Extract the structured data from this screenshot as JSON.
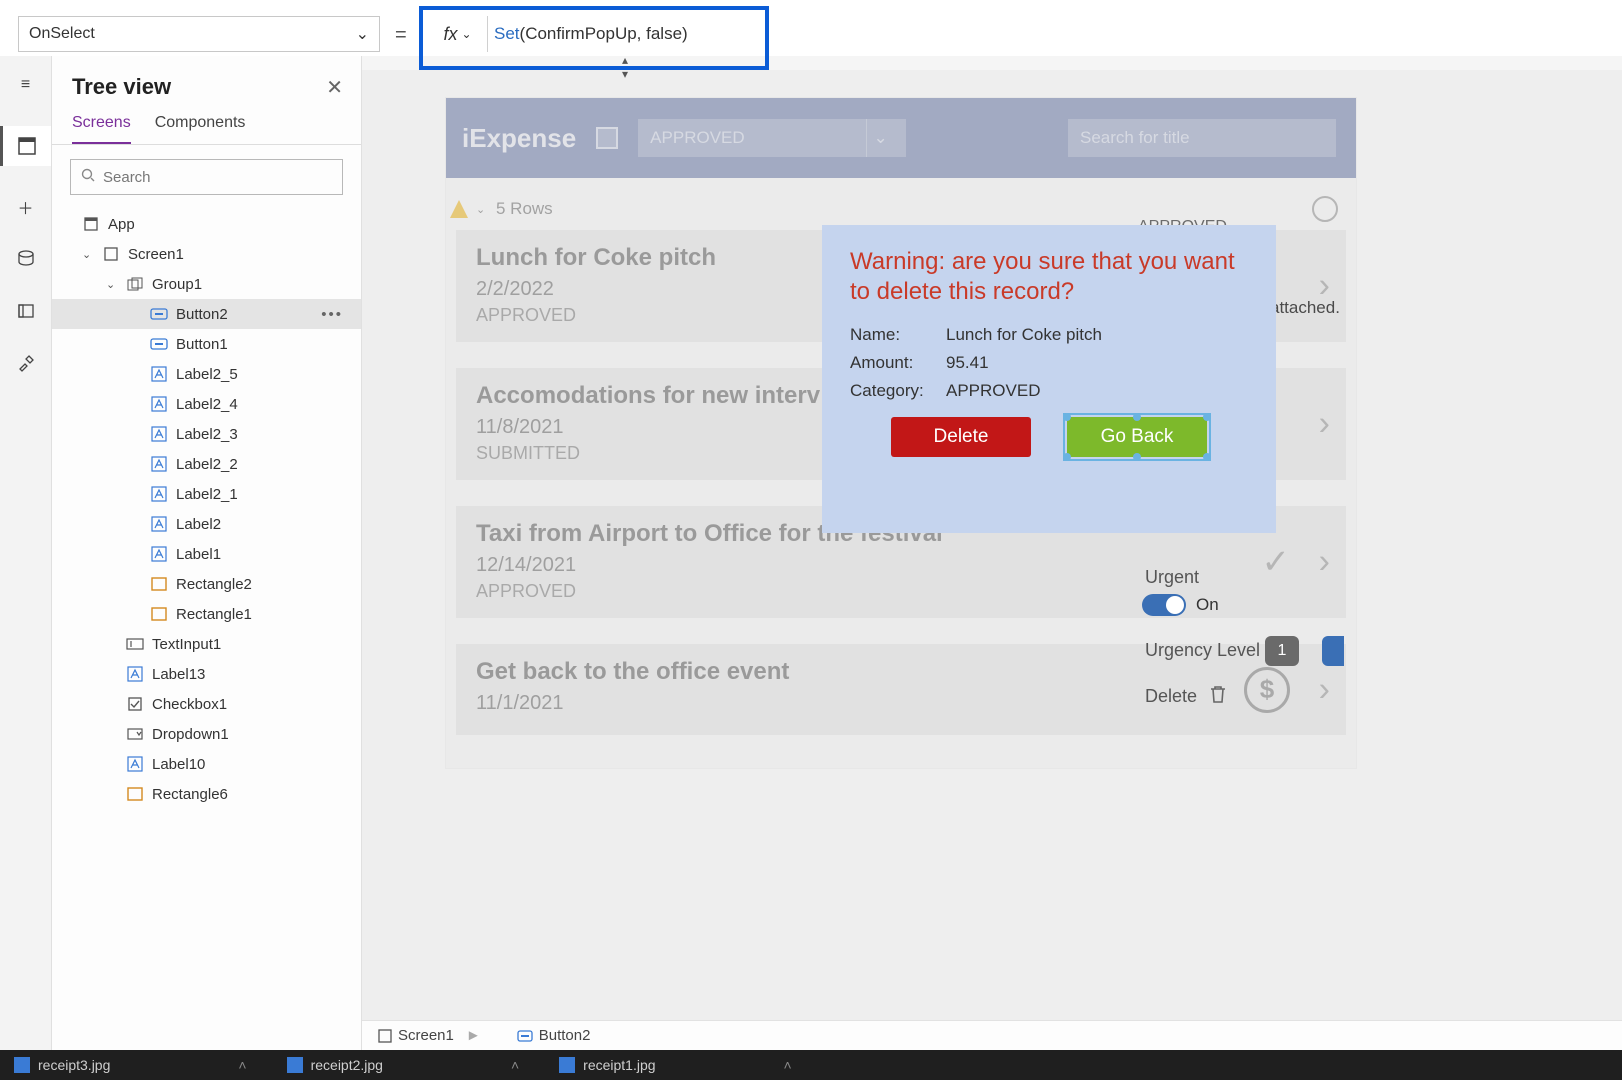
{
  "formula_bar": {
    "property": "OnSelect",
    "fx_label": "fx",
    "formula_fn": "Set",
    "formula_rest": "(ConfirmPopUp, false)"
  },
  "tree": {
    "title": "Tree view",
    "tabs": {
      "screens": "Screens",
      "components": "Components"
    },
    "search_placeholder": "Search",
    "items": [
      {
        "label": "App",
        "indent": 0,
        "icon": "app",
        "chev": ""
      },
      {
        "label": "Screen1",
        "indent": 0,
        "icon": "screen",
        "chev": "v"
      },
      {
        "label": "Group1",
        "indent": 1,
        "icon": "group",
        "chev": "v"
      },
      {
        "label": "Button2",
        "indent": 2,
        "icon": "button",
        "selected": true,
        "more": true
      },
      {
        "label": "Button1",
        "indent": 2,
        "icon": "button"
      },
      {
        "label": "Label2_5",
        "indent": 2,
        "icon": "label"
      },
      {
        "label": "Label2_4",
        "indent": 2,
        "icon": "label"
      },
      {
        "label": "Label2_3",
        "indent": 2,
        "icon": "label"
      },
      {
        "label": "Label2_2",
        "indent": 2,
        "icon": "label"
      },
      {
        "label": "Label2_1",
        "indent": 2,
        "icon": "label"
      },
      {
        "label": "Label2",
        "indent": 2,
        "icon": "label"
      },
      {
        "label": "Label1",
        "indent": 2,
        "icon": "label"
      },
      {
        "label": "Rectangle2",
        "indent": 2,
        "icon": "rect"
      },
      {
        "label": "Rectangle1",
        "indent": 2,
        "icon": "rect"
      },
      {
        "label": "TextInput1",
        "indent": 1,
        "icon": "textinput"
      },
      {
        "label": "Label13",
        "indent": 1,
        "icon": "label"
      },
      {
        "label": "Checkbox1",
        "indent": 1,
        "icon": "checkbox"
      },
      {
        "label": "Dropdown1",
        "indent": 1,
        "icon": "dropdown"
      },
      {
        "label": "Label10",
        "indent": 1,
        "icon": "label"
      },
      {
        "label": "Rectangle6",
        "indent": 1,
        "icon": "rect"
      }
    ]
  },
  "app": {
    "title": "iExpense",
    "dd_value": "APPROVED",
    "search_placeholder": "Search for title",
    "rows_label": "5 Rows",
    "side": {
      "approved": "APPROVED",
      "attached": "attached.",
      "urgent_label": "Urgent",
      "toggle_label": "On",
      "urgency_label": "Urgency Level",
      "urgency_value": "1",
      "delete_label": "Delete"
    },
    "records": [
      {
        "title": "Lunch for Coke pitch",
        "date": "2/2/2022",
        "status": "APPROVED"
      },
      {
        "title": "Accomodations for new interv",
        "date": "11/8/2021",
        "status": "SUBMITTED"
      },
      {
        "title": "Taxi from Airport to Office for the festival",
        "date": "12/14/2021",
        "status": "APPROVED",
        "approve": true
      },
      {
        "title": "Get back to the office event",
        "date": "11/1/2021",
        "status": "",
        "dollar": true
      }
    ]
  },
  "popup": {
    "warning": "Warning: are you sure that you want to delete this record?",
    "name_k": "Name:",
    "name_v": "Lunch for Coke pitch",
    "amount_k": "Amount:",
    "amount_v": "95.41",
    "cat_k": "Category:",
    "cat_v": "APPROVED",
    "delete": "Delete",
    "goback": "Go Back"
  },
  "bottom_tabs": {
    "screen": "Screen1",
    "button": "Button2"
  },
  "taskbar": {
    "f1": "receipt3.jpg",
    "f2": "receipt2.jpg",
    "f3": "receipt1.jpg"
  }
}
